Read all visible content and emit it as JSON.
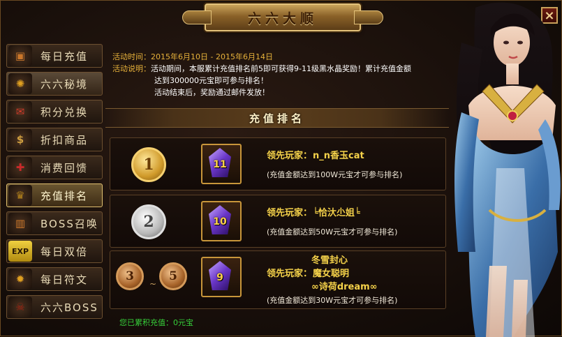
{
  "window": {
    "title": "六六大顺",
    "close_icon": "×"
  },
  "sidebar": {
    "items": [
      {
        "label": "每日充值",
        "icon": "treasure-chest-icon",
        "icon_glyph": "▣",
        "icon_color": "#c9762a"
      },
      {
        "label": "六六秘境",
        "icon": "sun-emblem-icon",
        "icon_glyph": "✺",
        "icon_color": "#e0a020"
      },
      {
        "label": "积分兑换",
        "icon": "gift-scroll-icon",
        "icon_glyph": "✉",
        "icon_color": "#d03a2a"
      },
      {
        "label": "折扣商品",
        "icon": "money-bag-icon",
        "icon_glyph": "$",
        "icon_color": "#d0a040"
      },
      {
        "label": "消费回馈",
        "icon": "gift-box-icon",
        "icon_glyph": "✚",
        "icon_color": "#c82a2a"
      },
      {
        "label": "充值排名",
        "icon": "trophy-icon",
        "icon_glyph": "♛",
        "icon_color": "#b0801a"
      },
      {
        "label": "BOSS召唤",
        "icon": "chest-icon",
        "icon_glyph": "▥",
        "icon_color": "#c9762a"
      },
      {
        "label": "每日双倍",
        "icon": "exp-icon",
        "icon_glyph": "EXP",
        "icon_color": "#e0c020"
      },
      {
        "label": "每日符文",
        "icon": "rune-icon",
        "icon_glyph": "✹",
        "icon_color": "#e0a020"
      },
      {
        "label": "六六BOSS",
        "icon": "demon-mask-icon",
        "icon_glyph": "☠",
        "icon_color": "#a02010"
      }
    ]
  },
  "event": {
    "time_label": "活动时间：",
    "time_value": "2015年6月10日 - 2015年6月14日",
    "desc_label": "活动说明：",
    "desc_line1": "活动期间，本服累计充值排名前5即可获得9-11级黑水晶奖励！累计充值金额",
    "desc_line2": "达到300000元宝即可参与排名！",
    "desc_line3": "活动结束后，奖励通过邮件发放！"
  },
  "ranking": {
    "header": "充值排名",
    "rows": [
      {
        "rank": "1",
        "gem_level": "11",
        "leader_label": "领先玩家：",
        "names": [
          "n_n香玉cat"
        ],
        "note": "(充值金额达到100W元宝才可参与排名)"
      },
      {
        "rank": "2",
        "gem_level": "10",
        "leader_label": "领先玩家：",
        "names": [
          "╘恰汏尐姐╘"
        ],
        "note": "(充值金额达到50W元宝才可参与排名)"
      },
      {
        "rank_from": "3",
        "rank_sep": "~",
        "rank_to": "5",
        "gem_level": "9",
        "leader_label": "领先玩家：",
        "names": [
          "冬雪封心",
          "魔女聪明",
          "∞诗荷dream∞"
        ],
        "note": "(充值金额达到30W元宝才可参与排名)"
      }
    ]
  },
  "footer": {
    "total_text": "您已累积充值：0元宝"
  },
  "colors": {
    "gold_text": "#f5d24a",
    "green_text": "#36d03a",
    "accent": "#e6b13a"
  }
}
